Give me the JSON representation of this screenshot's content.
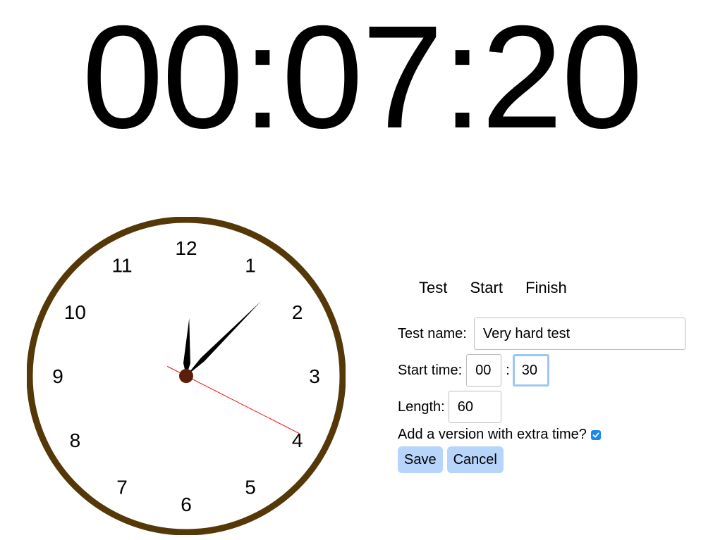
{
  "timer": {
    "display": "00:07:20"
  },
  "clock": {
    "numerals": [
      "12",
      "1",
      "2",
      "3",
      "4",
      "5",
      "6",
      "7",
      "8",
      "9",
      "10",
      "11"
    ],
    "hour_value": 0.1,
    "minute_value": 7.5,
    "second_value": 19.5,
    "rim_color": "#553808",
    "hub_color": "#5a1e0a",
    "second_hand_color": "#ff0000"
  },
  "tabs": {
    "test": "Test",
    "start": "Start",
    "finish": "Finish"
  },
  "form": {
    "test_name_label": "Test name:",
    "test_name_value": "Very hard test",
    "start_time_label": "Start time:",
    "start_hours": "00",
    "time_separator": ":",
    "start_minutes": "30",
    "length_label": "Length:",
    "length_value": "60",
    "extra_time_label": "Add a version with extra time?",
    "extra_time_checked": true,
    "save_label": "Save",
    "cancel_label": "Cancel"
  },
  "colors": {
    "button_bg": "#b7d4fa",
    "checkbox": "#1e88f0",
    "focus": "#9ec6f5"
  }
}
